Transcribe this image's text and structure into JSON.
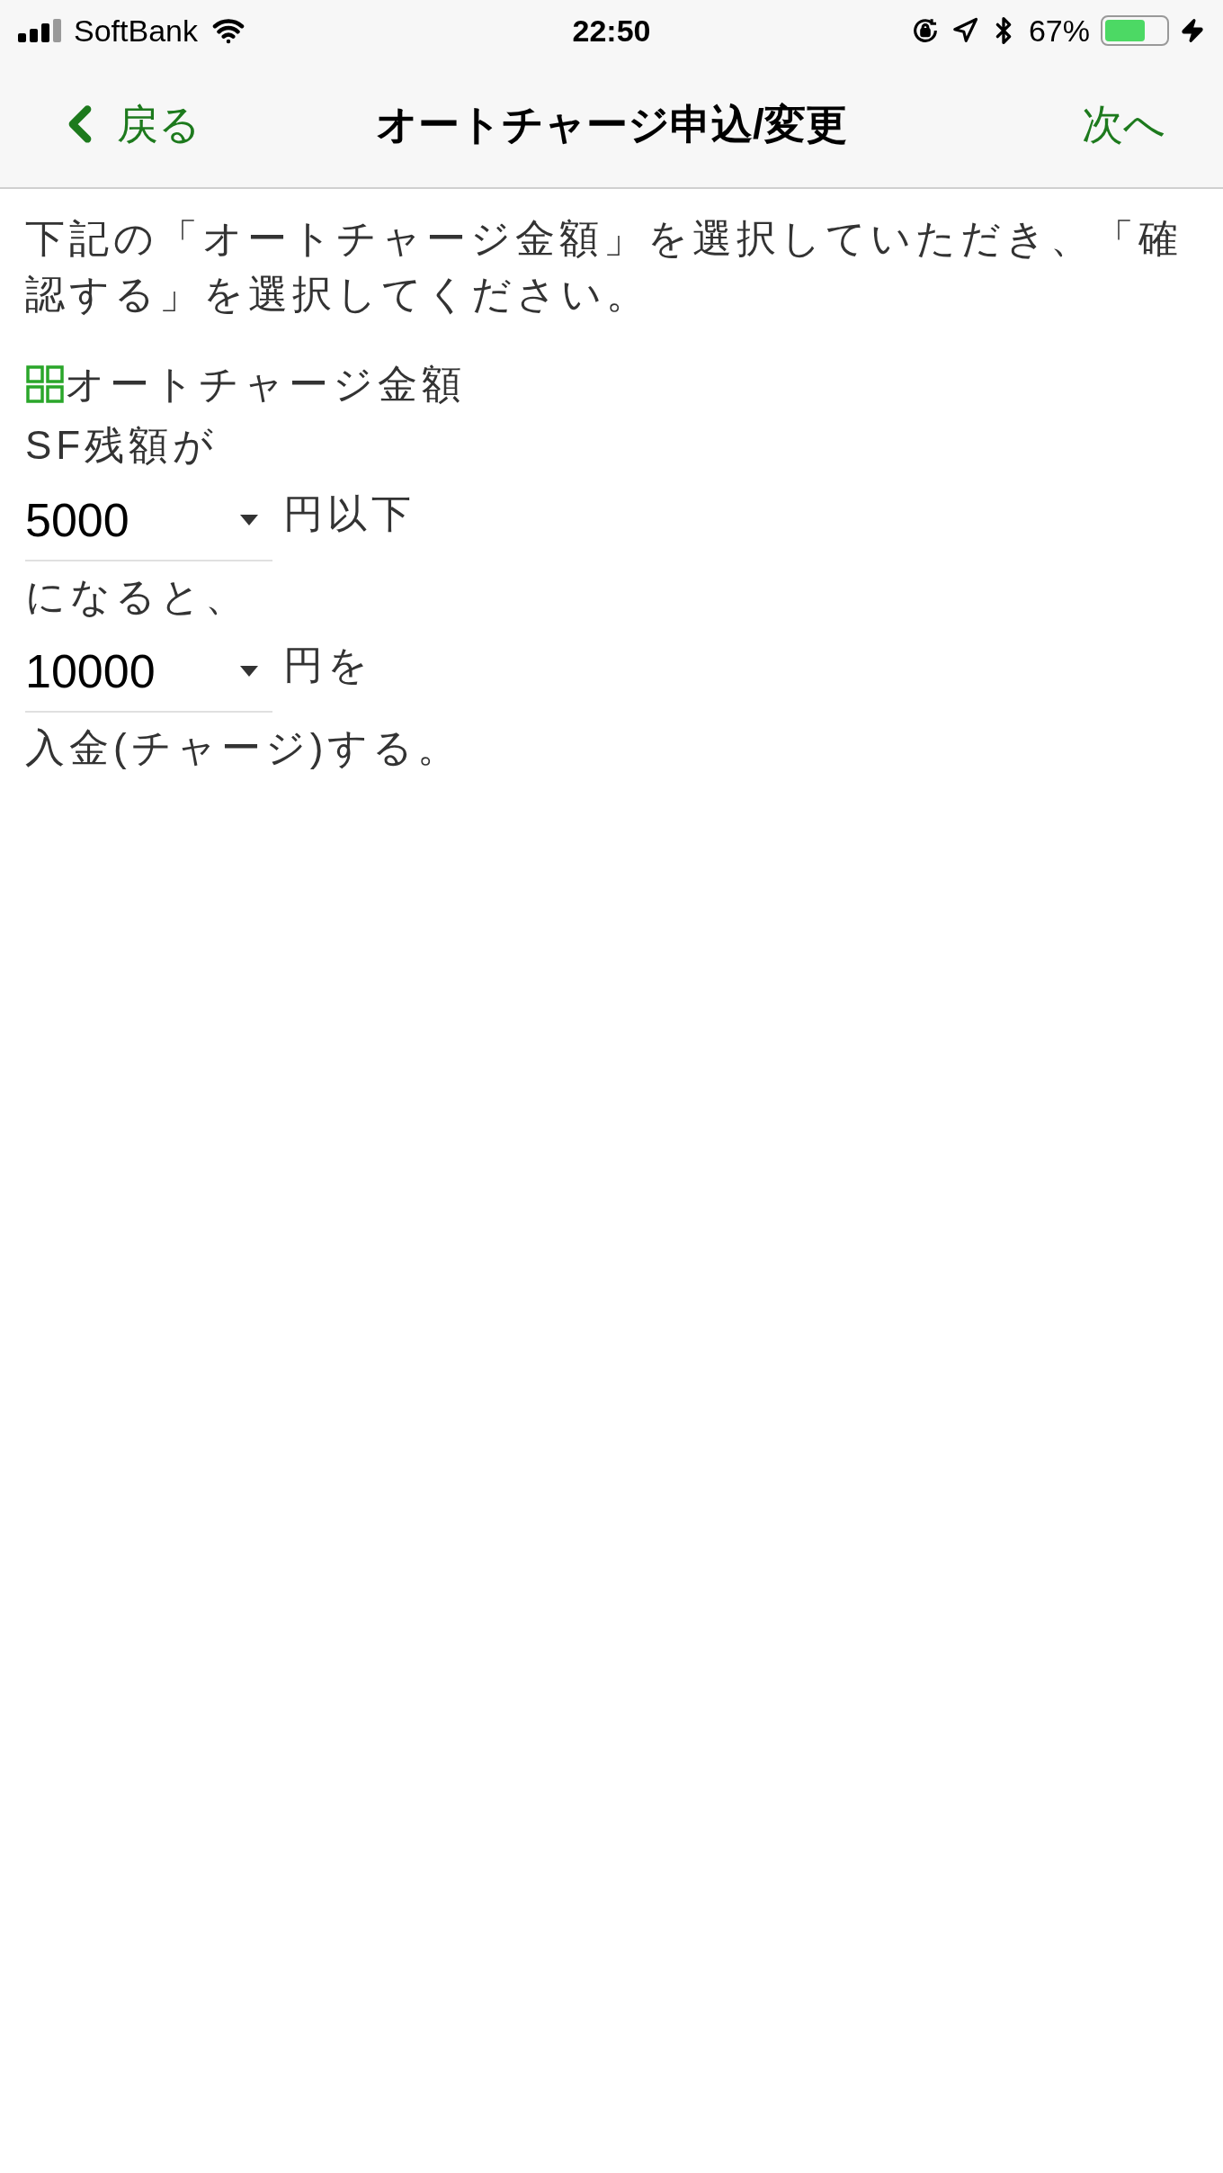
{
  "status_bar": {
    "carrier": "SoftBank",
    "time": "22:50",
    "battery": "67%"
  },
  "nav": {
    "back": "戻る",
    "title": "オートチャージ申込/変更",
    "next": "次へ"
  },
  "instruction": "下記の「オートチャージ金額」を選択していただき、「確認する」を選択してください。",
  "section_title": "オートチャージ金額",
  "lines": [
    {
      "kind": "text",
      "text": "SF残額が"
    },
    {
      "kind": "select",
      "value": "5000",
      "suffix": "円以下"
    },
    {
      "kind": "text",
      "text": "になると、"
    },
    {
      "kind": "select",
      "value": "10000",
      "suffix": "円を"
    },
    {
      "kind": "text",
      "text": "入金(チャージ)する。"
    }
  ]
}
